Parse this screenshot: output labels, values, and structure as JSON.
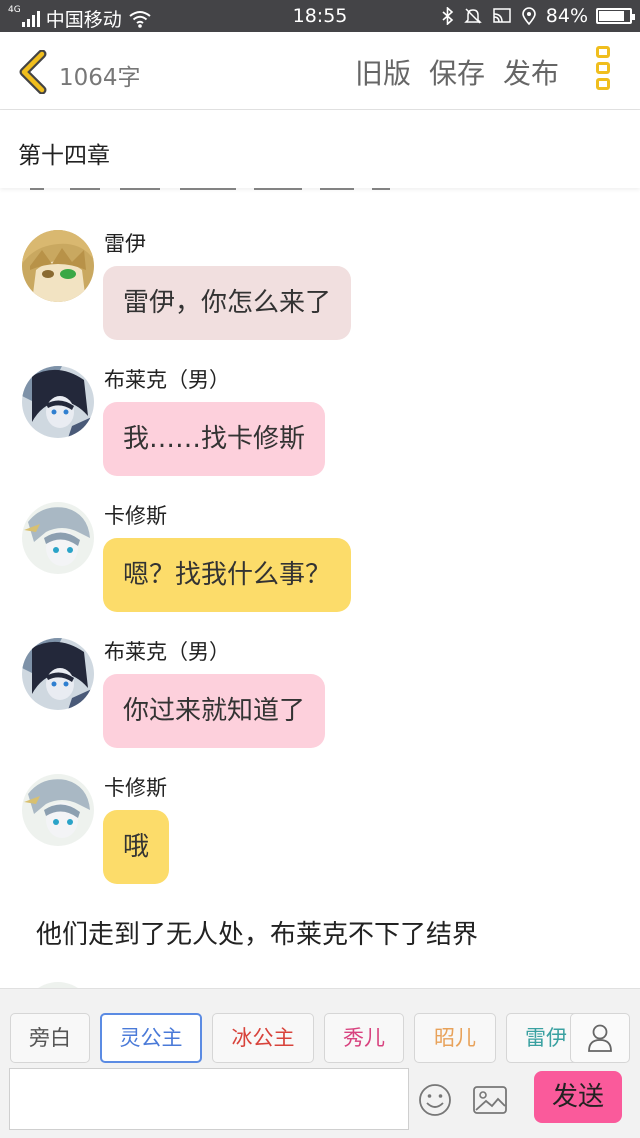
{
  "status_bar": {
    "signal_label": "4G",
    "carrier": "中国移动",
    "time": "18:55",
    "battery": "84%",
    "battery_level": 0.84,
    "icons": [
      "signal-icon",
      "wifi-icon",
      "bluetooth-icon",
      "mute-icon",
      "cast-icon",
      "location-icon",
      "battery-icon"
    ]
  },
  "header": {
    "back_icon": "chevron-left-icon",
    "word_count": "1064字",
    "old_version": "旧版",
    "save": "保存",
    "publish": "发布",
    "more_icon": "more-vertical-icon",
    "accent": "#f0be1e"
  },
  "chapter": {
    "title": "第十四章"
  },
  "messages": [
    {
      "name": "雷伊",
      "text": "雷伊，你怎么来了",
      "bubble_color": "#f1dfdf",
      "avatar": "rey-avatar"
    },
    {
      "name": "布莱克（男）",
      "text": "我……找卡修斯",
      "bubble_color": "#fdd0dc",
      "avatar": "blake-avatar"
    },
    {
      "name": "卡修斯",
      "text": "嗯？找我什么事？",
      "bubble_color": "#fcdc6a",
      "avatar": "cassius-avatar"
    },
    {
      "name": "布莱克（男）",
      "text": "你过来就知道了",
      "bubble_color": "#fdd0dc",
      "avatar": "blake-avatar"
    },
    {
      "name": "卡修斯",
      "text": "哦",
      "bubble_color": "#fcdc6a",
      "avatar": "cassius-avatar"
    }
  ],
  "narration": "他们走到了无人处，布莱克不下了结界",
  "bottom": {
    "roles": [
      {
        "label": "旁白",
        "color": "#555555"
      },
      {
        "label": "灵公主",
        "color": "#4a7ad8",
        "selected": true
      },
      {
        "label": "冰公主",
        "color": "#d8433b"
      },
      {
        "label": "秀儿",
        "color": "#d8437f"
      },
      {
        "label": "昭儿",
        "color": "#e8a25a"
      },
      {
        "label": "雷伊",
        "color": "#3aa1a1"
      }
    ],
    "person_icon": "person-icon",
    "input_placeholder": "",
    "emoji_icon": "smiley-icon",
    "image_icon": "image-icon",
    "send": "发送",
    "send_color": "#fa5a9b"
  }
}
